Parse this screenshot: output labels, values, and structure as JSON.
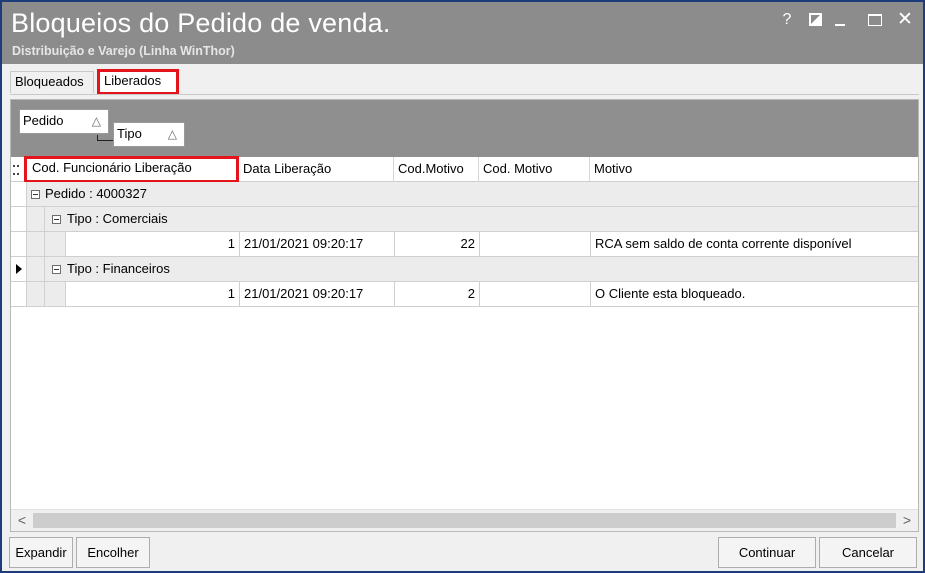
{
  "window": {
    "title": "Bloqueios do Pedido de venda.",
    "subtitle": "Distribuição e Varejo (Linha WinThor)",
    "controls": {
      "help": "?",
      "close": "✕"
    }
  },
  "tabs": [
    {
      "label": "Bloqueados",
      "active": false
    },
    {
      "label": "Liberados",
      "active": true
    }
  ],
  "group_panel": {
    "groups": [
      {
        "label": "Pedido",
        "sort_icon": "△"
      },
      {
        "label": "Tipo",
        "sort_icon": "△"
      }
    ]
  },
  "columns": [
    "Cod. Funcionário Liberação",
    "Data Liberação",
    "Cod.Motivo",
    "Cod. Motivo",
    "Motivo"
  ],
  "pedido_group": {
    "label": "Pedido : 4000327"
  },
  "tipo_groups": [
    {
      "label": "Tipo : Comerciais",
      "rows": [
        {
          "cod_func": "1",
          "data": "21/01/2021 09:20:17",
          "cod_motivo": "22",
          "cod_motivo2": "",
          "motivo": "RCA sem saldo de conta corrente disponível"
        }
      ]
    },
    {
      "label": "Tipo : Financeiros",
      "rows": [
        {
          "cod_func": "1",
          "data": "21/01/2021 09:20:17",
          "cod_motivo": "2",
          "cod_motivo2": "",
          "motivo": "O Cliente esta bloqueado."
        }
      ]
    }
  ],
  "scrollbar": {
    "left": "<",
    "right": ">"
  },
  "buttons": {
    "expandir": "Expandir",
    "encolher": "Encolher",
    "continuar": "Continuar",
    "cancelar": "Cancelar"
  },
  "colors": {
    "title_bar": "#8c8c8c",
    "highlight": "#e3141b",
    "window_border": "#1f3c7a"
  }
}
